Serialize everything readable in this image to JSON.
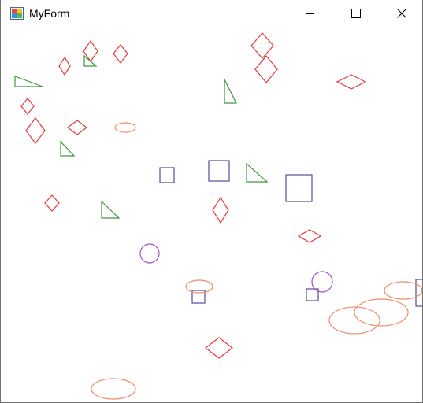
{
  "window": {
    "title": "MyForm",
    "icon": "winforms-app-icon",
    "controls": {
      "minimize_icon": "minimize-icon",
      "maximize_icon": "maximize-icon",
      "close_icon": "close-icon"
    }
  },
  "colors": {
    "diamond": "#e8373a",
    "triangle": "#3a9a3a",
    "square": "#5a4a9a",
    "circle": "#a24ed4",
    "ellipse": "#f08c6a",
    "border": "#707070"
  }
}
